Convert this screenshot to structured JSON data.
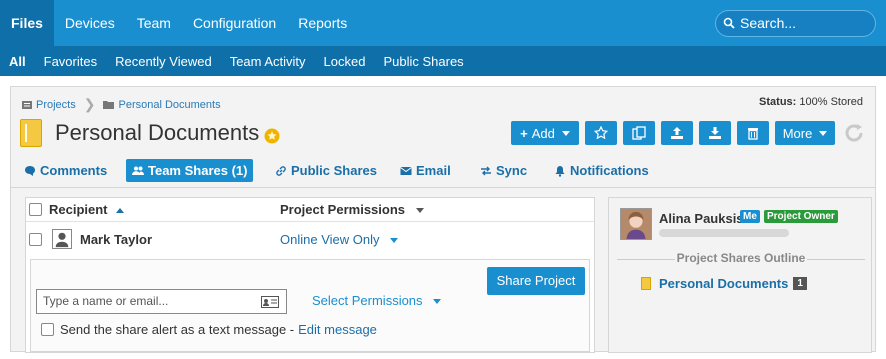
{
  "topnav": {
    "items": [
      {
        "label": "Files",
        "active": true
      },
      {
        "label": "Devices"
      },
      {
        "label": "Team"
      },
      {
        "label": "Configuration"
      },
      {
        "label": "Reports"
      }
    ],
    "search_placeholder": "Search..."
  },
  "subnav": {
    "items": [
      {
        "label": "All",
        "active": true
      },
      {
        "label": "Favorites"
      },
      {
        "label": "Recently Viewed"
      },
      {
        "label": "Team Activity"
      },
      {
        "label": "Locked"
      },
      {
        "label": "Public Shares"
      }
    ]
  },
  "breadcrumb": {
    "items": [
      "Projects",
      "Personal Documents"
    ]
  },
  "status": {
    "label": "Status:",
    "value": "100% Stored"
  },
  "project": {
    "title": "Personal Documents"
  },
  "toolbar": {
    "add_label": "Add",
    "more_label": "More"
  },
  "tabs": [
    {
      "label": "Comments",
      "icon": "comment-icon"
    },
    {
      "label": "Team Shares (1)",
      "icon": "users-icon",
      "active": true
    },
    {
      "label": "Public Shares",
      "icon": "link-icon"
    },
    {
      "label": "Email",
      "icon": "envelope-icon"
    },
    {
      "label": "Sync",
      "icon": "sync-icon"
    },
    {
      "label": "Notifications",
      "icon": "bell-icon"
    }
  ],
  "shares_table": {
    "col_recipient": "Recipient",
    "col_permissions": "Project Permissions",
    "rows": [
      {
        "name": "Mark Taylor",
        "permission": "Online View Only"
      }
    ]
  },
  "share_form": {
    "input_placeholder": "Type a name or email...",
    "select_label": "Select Permissions",
    "share_button": "Share Project",
    "alert_text": "Send the share alert as a text message -",
    "edit_link": "Edit message"
  },
  "owner": {
    "name": "Alina Pauksis",
    "badge_me": "Me",
    "badge_owner": "Project Owner"
  },
  "outline": {
    "title": "Project Shares Outline",
    "item": "Personal Documents",
    "count": "1"
  },
  "colors": {
    "accent": "#1a8fcf",
    "nav_dark": "#0f6fa8",
    "owner_green": "#2a9a3a"
  }
}
